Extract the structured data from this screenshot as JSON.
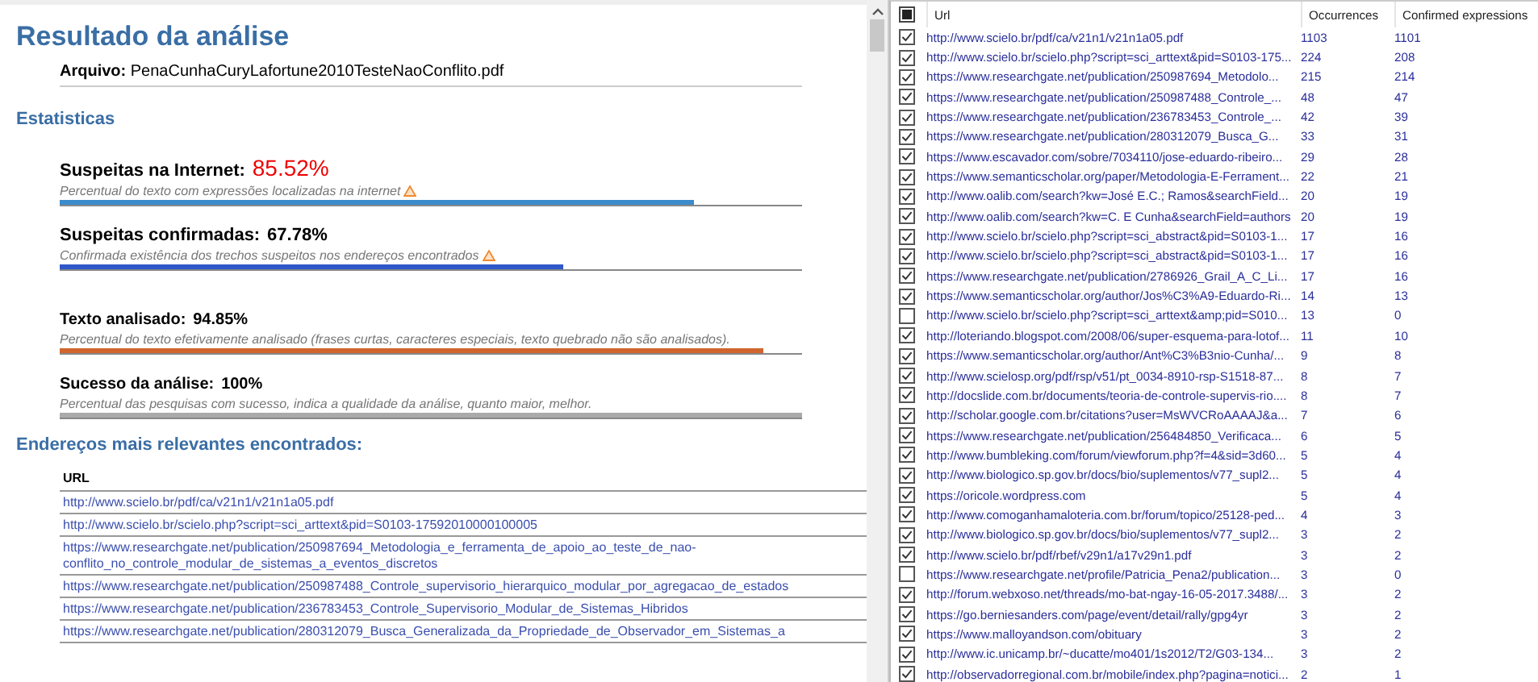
{
  "report": {
    "title": "Resultado da análise",
    "file_label": "Arquivo:",
    "file_name": "PenaCunhaCuryLafortune2010TesteNaoConflito.pdf",
    "stats_heading": "Estatisticas",
    "stats": [
      {
        "kind": "primary",
        "label": "Suspeitas na Internet:",
        "value": "85.52%",
        "alert": true,
        "description": "Percentual do texto com expressões localizadas na internet",
        "warning": true,
        "level": 0.8552,
        "color": "#3a8ccc"
      },
      {
        "kind": "primary",
        "label": "Suspeitas confirmadas:",
        "value": "67.78%",
        "alert": false,
        "description": "Confirmada existência dos trechos suspeitos nos endereços encontrados",
        "warning": true,
        "level": 0.6778,
        "color": "#2f58c8"
      },
      {
        "kind": "secondary",
        "label": "Texto analisado:",
        "value": "94.85%",
        "alert": false,
        "description": "Percentual do texto efetivamente analisado (frases curtas, caracteres especiais, texto quebrado não são analisados).",
        "warning": false,
        "level": 0.9485,
        "color": "#d0652e"
      },
      {
        "kind": "secondary",
        "label": "Sucesso da análise:",
        "value": "100%",
        "alert": false,
        "description": "Percentual das pesquisas com sucesso, indica a qualidade da análise, quanto maior, melhor.",
        "warning": false,
        "level": 1,
        "color": "#aaaaaa"
      }
    ],
    "addresses_heading": "Endereços mais relevantes encontrados:",
    "addresses_column": "URL",
    "addresses": [
      "http://www.scielo.br/pdf/ca/v21n1/v21n1a05.pdf",
      "http://www.scielo.br/scielo.php?script=sci_arttext&pid=S0103-17592010000100005",
      "https://www.researchgate.net/publication/250987694_Metodologia_e_ferramenta_de_apoio_ao_teste_de_nao-conflito_no_controle_modular_de_sistemas_a_eventos_discretos",
      "https://www.researchgate.net/publication/250987488_Controle_supervisorio_hierarquico_modular_por_agregacao_de_estados",
      "https://www.researchgate.net/publication/236783453_Controle_Supervisorio_Modular_de_Sistemas_Hibridos",
      "https://www.researchgate.net/publication/280312079_Busca_Generalizada_da_Propriedade_de_Observador_em_Sistemas_a"
    ]
  },
  "results": {
    "select_all_indeterminate": true,
    "columns": [
      "Url",
      "Occurrences",
      "Confirmed expressions"
    ],
    "rows": [
      {
        "checked": true,
        "url": "http://www.scielo.br/pdf/ca/v21n1/v21n1a05.pdf",
        "occurrences": "1103",
        "confirmed": "1101"
      },
      {
        "checked": true,
        "url": "http://www.scielo.br/scielo.php?script=sci_arttext&pid=S0103-175...",
        "occurrences": "224",
        "confirmed": "208"
      },
      {
        "checked": true,
        "url": "https://www.researchgate.net/publication/250987694_Metodolo...",
        "occurrences": "215",
        "confirmed": "214"
      },
      {
        "checked": true,
        "url": "https://www.researchgate.net/publication/250987488_Controle_...",
        "occurrences": "48",
        "confirmed": "47"
      },
      {
        "checked": true,
        "url": "https://www.researchgate.net/publication/236783453_Controle_...",
        "occurrences": "42",
        "confirmed": "39"
      },
      {
        "checked": true,
        "url": "https://www.researchgate.net/publication/280312079_Busca_G...",
        "occurrences": "33",
        "confirmed": "31"
      },
      {
        "checked": true,
        "url": "https://www.escavador.com/sobre/7034110/jose-eduardo-ribeiro...",
        "occurrences": "29",
        "confirmed": "28"
      },
      {
        "checked": true,
        "url": "https://www.semanticscholar.org/paper/Metodologia-E-Ferrament...",
        "occurrences": "22",
        "confirmed": "21"
      },
      {
        "checked": true,
        "url": "http://www.oalib.com/search?kw=José E.C.; Ramos&searchField...",
        "occurrences": "20",
        "confirmed": "19"
      },
      {
        "checked": true,
        "url": "http://www.oalib.com/search?kw=C. E Cunha&searchField=authors",
        "occurrences": "20",
        "confirmed": "19"
      },
      {
        "checked": true,
        "url": "http://www.scielo.br/scielo.php?script=sci_abstract&pid=S0103-1...",
        "occurrences": "17",
        "confirmed": "16"
      },
      {
        "checked": true,
        "url": "http://www.scielo.br/scielo.php?script=sci_abstract&pid=S0103-1...",
        "occurrences": "17",
        "confirmed": "16"
      },
      {
        "checked": true,
        "url": "https://www.researchgate.net/publication/2786926_Grail_A_C_Li...",
        "occurrences": "17",
        "confirmed": "16"
      },
      {
        "checked": true,
        "url": "https://www.semanticscholar.org/author/Jos%C3%A9-Eduardo-Ri...",
        "occurrences": "14",
        "confirmed": "13"
      },
      {
        "checked": false,
        "url": "http://www.scielo.br/scielo.php?script=sci_arttext&amp;pid=S010...",
        "occurrences": "13",
        "confirmed": "0"
      },
      {
        "checked": true,
        "url": "http://loteriando.blogspot.com/2008/06/super-esquema-para-lotof...",
        "occurrences": "11",
        "confirmed": "10"
      },
      {
        "checked": true,
        "url": "https://www.semanticscholar.org/author/Ant%C3%B3nio-Cunha/...",
        "occurrences": "9",
        "confirmed": "8"
      },
      {
        "checked": true,
        "url": "http://www.scielosp.org/pdf/rsp/v51/pt_0034-8910-rsp-S1518-87...",
        "occurrences": "8",
        "confirmed": "7"
      },
      {
        "checked": true,
        "url": "http://docslide.com.br/documents/teoria-de-controle-supervis-rio....",
        "occurrences": "8",
        "confirmed": "7"
      },
      {
        "checked": true,
        "url": "http://scholar.google.com.br/citations?user=MsWVCRoAAAAJ&a...",
        "occurrences": "7",
        "confirmed": "6"
      },
      {
        "checked": true,
        "url": "https://www.researchgate.net/publication/256484850_Verificaca...",
        "occurrences": "6",
        "confirmed": "5"
      },
      {
        "checked": true,
        "url": "http://www.bumbleking.com/forum/viewforum.php?f=4&sid=3d60...",
        "occurrences": "5",
        "confirmed": "4"
      },
      {
        "checked": true,
        "url": "http://www.biologico.sp.gov.br/docs/bio/suplementos/v77_supl2...",
        "occurrences": "5",
        "confirmed": "4"
      },
      {
        "checked": true,
        "url": "https://oricole.wordpress.com",
        "occurrences": "5",
        "confirmed": "4"
      },
      {
        "checked": true,
        "url": "http://www.comoganhamaloteria.com.br/forum/topico/25128-ped...",
        "occurrences": "4",
        "confirmed": "3"
      },
      {
        "checked": true,
        "url": "http://www.biologico.sp.gov.br/docs/bio/suplementos/v77_supl2...",
        "occurrences": "3",
        "confirmed": "2"
      },
      {
        "checked": true,
        "url": "http://www.scielo.br/pdf/rbef/v29n1/a17v29n1.pdf",
        "occurrences": "3",
        "confirmed": "2"
      },
      {
        "checked": false,
        "url": "https://www.researchgate.net/profile/Patricia_Pena2/publication...",
        "occurrences": "3",
        "confirmed": "0"
      },
      {
        "checked": true,
        "url": "http://forum.webxoso.net/threads/mo-bat-ngay-16-05-2017.3488/...",
        "occurrences": "3",
        "confirmed": "2"
      },
      {
        "checked": true,
        "url": "https://go.berniesanders.com/page/event/detail/rally/gpg4yr",
        "occurrences": "3",
        "confirmed": "2"
      },
      {
        "checked": true,
        "url": "https://www.malloyandson.com/obituary",
        "occurrences": "3",
        "confirmed": "2"
      },
      {
        "checked": true,
        "url": "http://www.ic.unicamp.br/~ducatte/mo401/1s2012/T2/G03-134...",
        "occurrences": "3",
        "confirmed": "2"
      },
      {
        "checked": true,
        "url": "http://observadorregional.com.br/mobile/index.php?pagina=notici...",
        "occurrences": "2",
        "confirmed": "1"
      }
    ]
  }
}
